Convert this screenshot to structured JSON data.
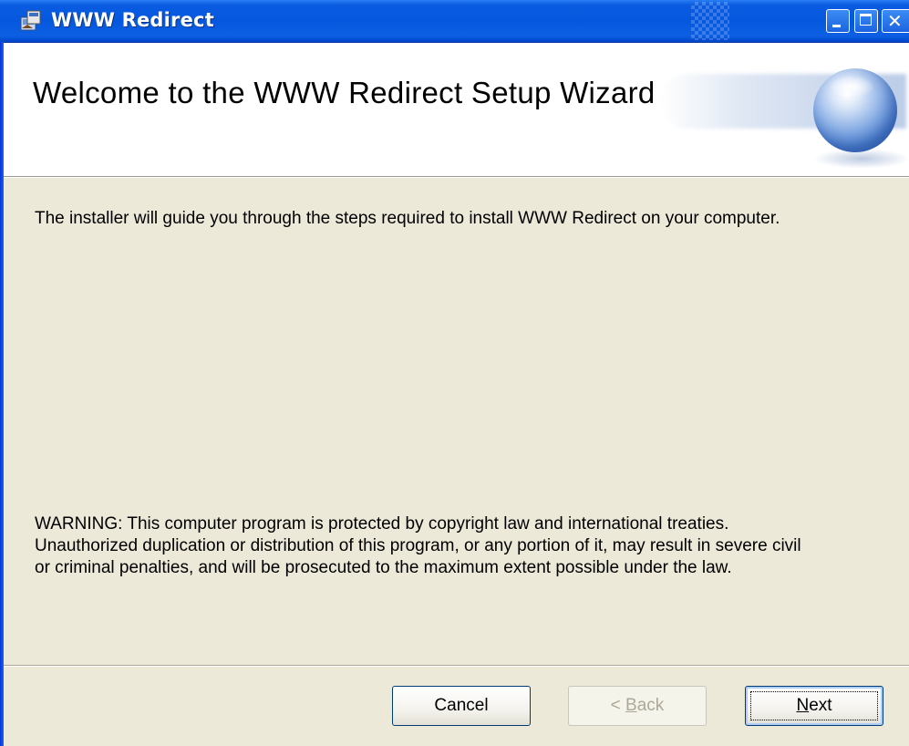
{
  "window": {
    "title": "WWW Redirect",
    "controls": {
      "minimize_icon": "minimize-icon",
      "maximize_icon": "maximize-icon",
      "close_glyph": "✕"
    }
  },
  "header": {
    "title": "Welcome to the WWW Redirect Setup Wizard"
  },
  "body": {
    "intro": "The installer will guide you through the steps required to install WWW Redirect on your computer.",
    "warning_lines": [
      "WARNING: This computer program is protected by copyright law and international treaties.",
      "Unauthorized duplication or distribution of this program, or any portion of it, may result in severe civil",
      "or criminal penalties, and will be prosecuted to the maximum extent possible under the law."
    ]
  },
  "buttons": {
    "cancel": "Cancel",
    "back_prefix": "< ",
    "back_mnemonic": "B",
    "back_rest": "ack",
    "next_mnemonic": "N",
    "next_rest": "ext"
  },
  "colors": {
    "titlebar": "#0558de",
    "dialog_bg": "#ece9d8",
    "banner_bg": "#ffffff",
    "disabled_text": "#aca899"
  }
}
